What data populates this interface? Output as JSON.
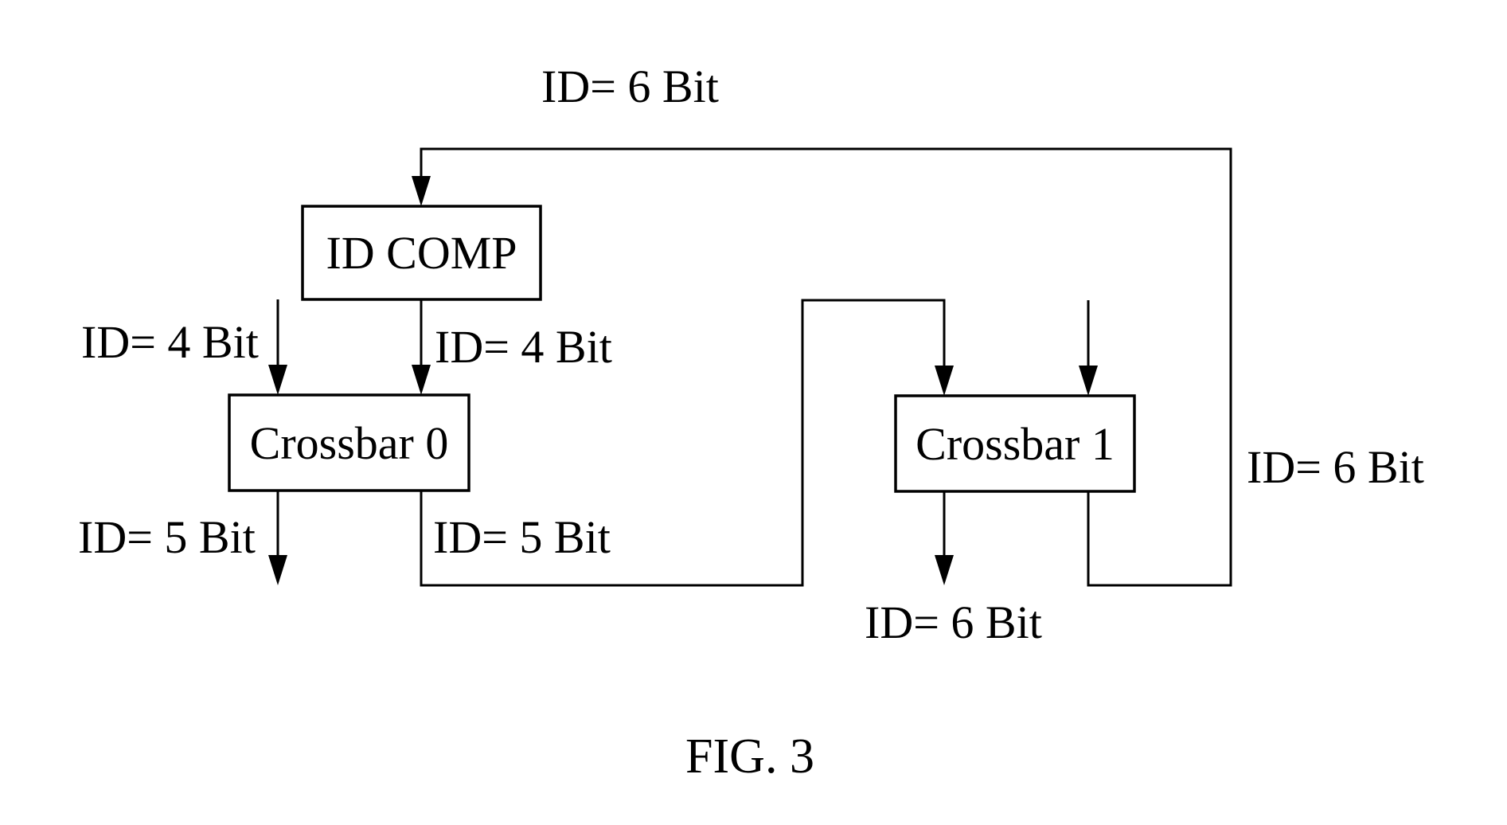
{
  "figure": {
    "caption": "FIG. 3",
    "blocks": {
      "id_comp": "ID COMP",
      "crossbar0": "Crossbar 0",
      "crossbar1": "Crossbar 1"
    },
    "labels": {
      "feedback_top": "ID= 6 Bit",
      "crossbar0_input_left": "ID= 4 Bit",
      "idcomp_to_crossbar0": "ID= 4 Bit",
      "crossbar0_output_left": "ID= 5 Bit",
      "crossbar0_output_right": "ID= 5 Bit",
      "crossbar1_feedback_right": "ID= 6 Bit",
      "crossbar1_output": "ID= 6 Bit"
    },
    "colors": {
      "ink": "#000000",
      "background": "#ffffff"
    }
  }
}
